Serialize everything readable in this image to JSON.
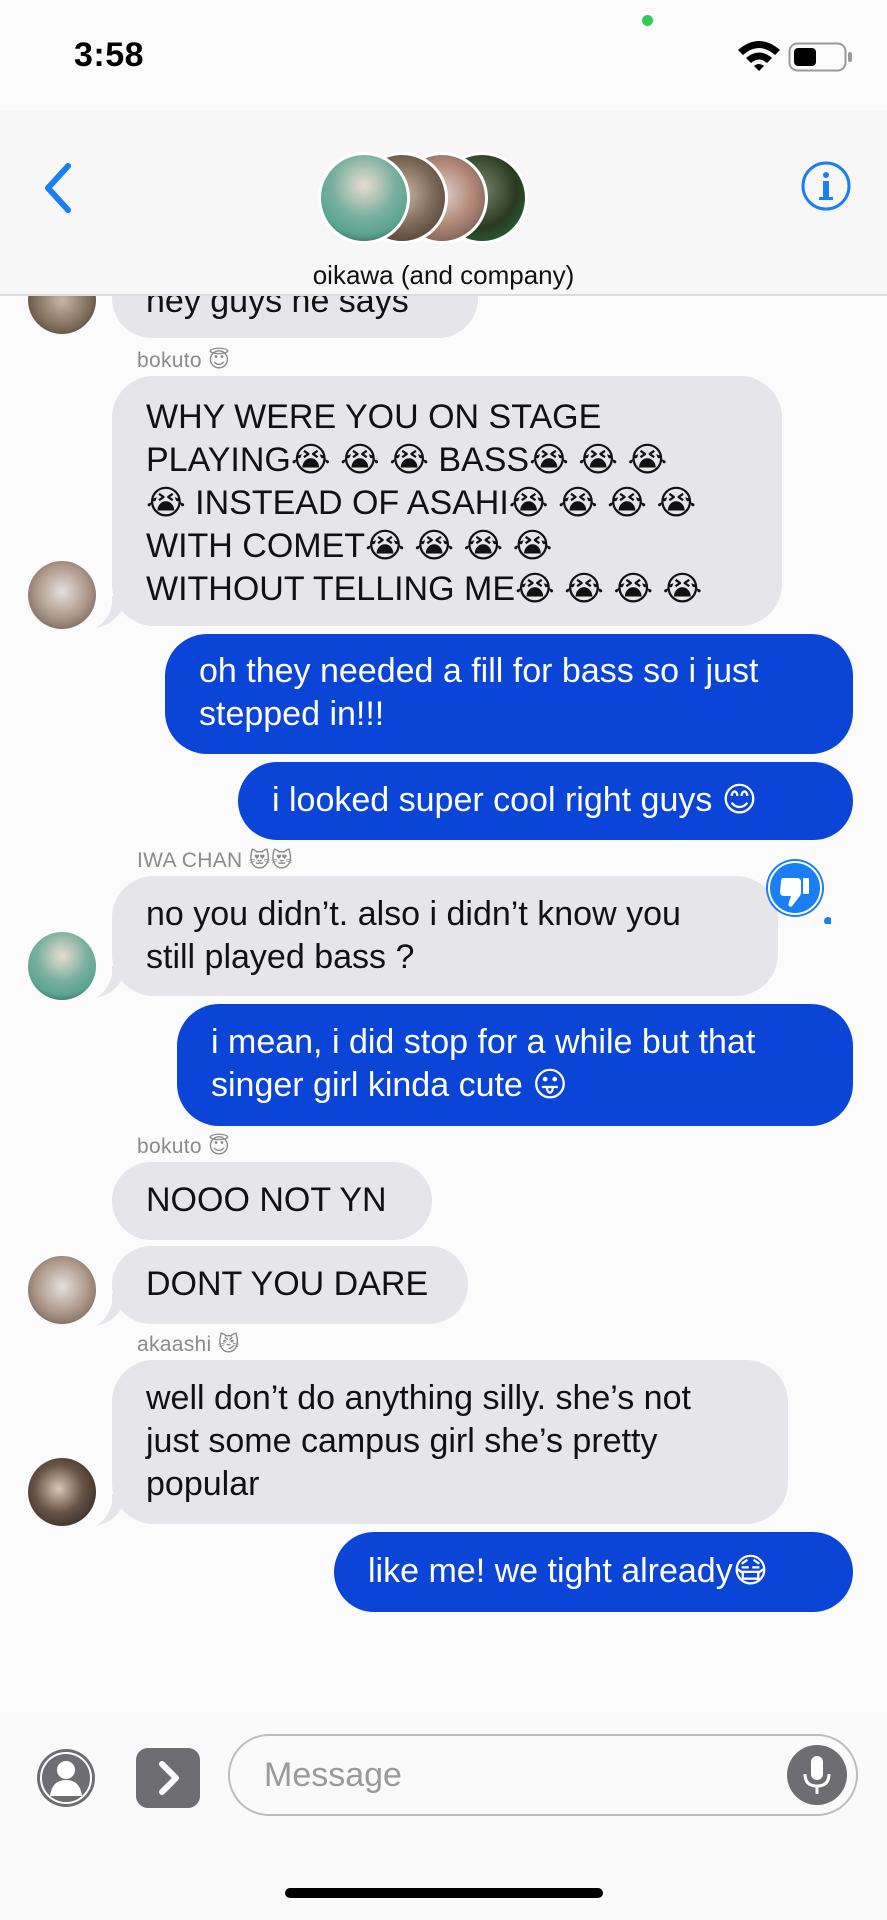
{
  "status_bar": {
    "time": "3:58"
  },
  "header": {
    "group_name": "oikawa (and company)"
  },
  "messages": [
    {
      "text": "hey guys  he says"
    },
    {
      "sender": "bokuto",
      "sender_emoji": "😇",
      "lines": [
        "WHY WERE YOU ON STAGE",
        "PLAYING😭 😭 😭  BASS😭 😭 😭",
        "😭  INSTEAD OF ASAHI😭 😭 😭 😭",
        "WITH COMET😭 😭 😭 😭",
        "WITHOUT TELLING ME😭 😭 😭 😭"
      ]
    },
    {
      "lines": [
        "oh they needed a fill for bass so i just",
        "stepped in!!!"
      ]
    },
    {
      "lines": [
        "i looked super cool right guys 😊"
      ]
    },
    {
      "sender": "IWA CHAN",
      "sender_emoji": "😻😻",
      "lines": [
        "no you didn’t. also i didn’t know you",
        "still played bass ?"
      ]
    },
    {
      "lines": [
        "i mean, i did stop for a while but that",
        "singer girl kinda cute 😛"
      ]
    },
    {
      "sender": "bokuto",
      "sender_emoji": "😇",
      "lines": [
        "NOOO NOT YN"
      ]
    },
    {
      "lines": [
        "DONT YOU DARE"
      ]
    },
    {
      "sender": "akaashi",
      "sender_emoji": "😼",
      "lines": [
        "well don’t do anything silly. she’s not",
        "just some campus girl she’s pretty",
        "popular"
      ]
    },
    {
      "lines": [
        "like me! we tight already😷"
      ]
    }
  ],
  "composer": {
    "placeholder": "Message"
  },
  "icons": [
    "wifi-icon",
    "battery-icon",
    "back-chevron-icon",
    "info-icon",
    "thumbs-down-reaction-icon",
    "contact-icon",
    "apps-chevron-icon",
    "microphone-icon"
  ],
  "colors": {
    "accent": "#1a7ef5",
    "outgoing": "#0a45d8",
    "incoming": "#e5e5ea"
  }
}
